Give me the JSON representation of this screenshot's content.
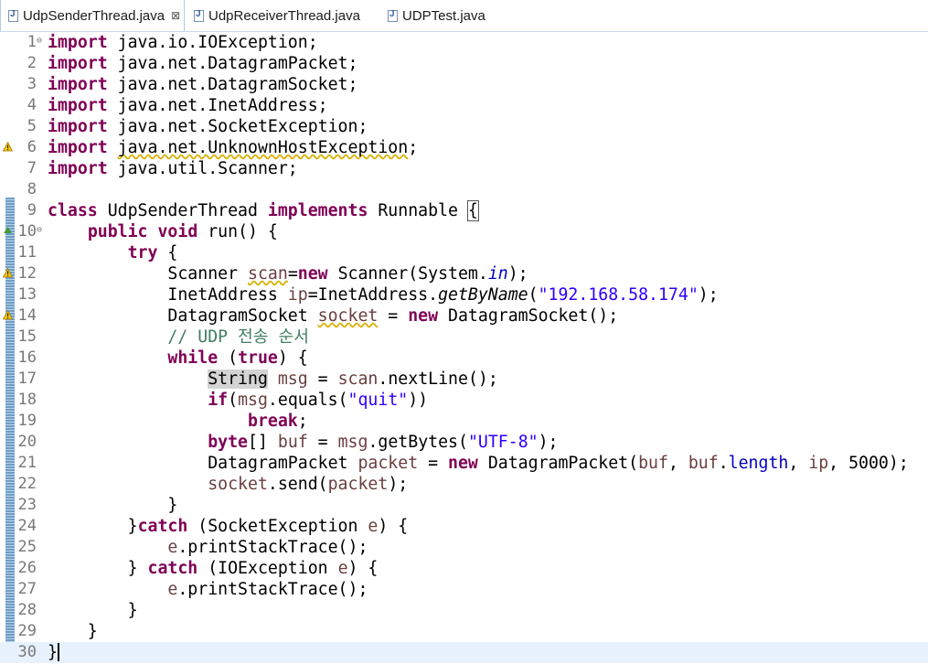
{
  "tabs": [
    {
      "label": "UdpSenderThread.java",
      "active": true,
      "close_glyph": "⊠"
    },
    {
      "label": "UdpReceiverThread.java",
      "active": false
    },
    {
      "label": "UDPTest.java",
      "active": false
    }
  ],
  "editor": {
    "current_line": 30,
    "lines": [
      {
        "n": "1",
        "fold": "⊖",
        "marker": null,
        "tokens": [
          {
            "t": "import",
            "c": "kw"
          },
          {
            "t": " java.io.IOException;"
          }
        ]
      },
      {
        "n": "2",
        "tokens": [
          {
            "t": "import",
            "c": "kw"
          },
          {
            "t": " java.net.DatagramPacket;"
          }
        ]
      },
      {
        "n": "3",
        "tokens": [
          {
            "t": "import",
            "c": "kw"
          },
          {
            "t": " java.net.DatagramSocket;"
          }
        ]
      },
      {
        "n": "4",
        "tokens": [
          {
            "t": "import",
            "c": "kw"
          },
          {
            "t": " java.net.InetAddress;"
          }
        ]
      },
      {
        "n": "5",
        "tokens": [
          {
            "t": "import",
            "c": "kw"
          },
          {
            "t": " java.net.SocketException;"
          }
        ]
      },
      {
        "n": "6",
        "marker": "warning",
        "tokens": [
          {
            "t": "import",
            "c": "kw"
          },
          {
            "t": " "
          },
          {
            "t": "java.net.UnknownHostException",
            "c": "wv"
          },
          {
            "t": ";"
          }
        ]
      },
      {
        "n": "7",
        "tokens": [
          {
            "t": "import",
            "c": "kw"
          },
          {
            "t": " java.util.Scanner;"
          }
        ]
      },
      {
        "n": "8",
        "tokens": []
      },
      {
        "n": "9",
        "tokens": [
          {
            "t": "class",
            "c": "kw"
          },
          {
            "t": " UdpSenderThread "
          },
          {
            "t": "implements",
            "c": "kw"
          },
          {
            "t": " Runnable "
          },
          {
            "t": "{",
            "c": "bx"
          }
        ]
      },
      {
        "n": "10",
        "fold": "⊖",
        "marker": "override",
        "tokens": [
          {
            "t": "    "
          },
          {
            "t": "public",
            "c": "kw"
          },
          {
            "t": " "
          },
          {
            "t": "void",
            "c": "kw"
          },
          {
            "t": " run() {"
          }
        ]
      },
      {
        "n": "11",
        "tokens": [
          {
            "t": "        "
          },
          {
            "t": "try",
            "c": "kw"
          },
          {
            "t": " {"
          }
        ]
      },
      {
        "n": "12",
        "marker": "warning",
        "tokens": [
          {
            "t": "            Scanner "
          },
          {
            "t": "scan",
            "c": "lv wv"
          },
          {
            "t": "="
          },
          {
            "t": "new",
            "c": "kw"
          },
          {
            "t": " Scanner(System."
          },
          {
            "t": "in",
            "c": "st"
          },
          {
            "t": ");"
          }
        ]
      },
      {
        "n": "13",
        "tokens": [
          {
            "t": "            InetAddress "
          },
          {
            "t": "ip",
            "c": "lv"
          },
          {
            "t": "=InetAddress."
          },
          {
            "t": "getByName",
            "c": "mi"
          },
          {
            "t": "("
          },
          {
            "t": "\"192.168.58.174\"",
            "c": "str"
          },
          {
            "t": ");"
          }
        ]
      },
      {
        "n": "14",
        "marker": "warning",
        "tokens": [
          {
            "t": "            DatagramSocket "
          },
          {
            "t": "socket",
            "c": "lv wv"
          },
          {
            "t": " = "
          },
          {
            "t": "new",
            "c": "kw"
          },
          {
            "t": " DatagramSocket();"
          }
        ]
      },
      {
        "n": "15",
        "tokens": [
          {
            "t": "            "
          },
          {
            "t": "// UDP 전송 순서",
            "c": "cmt"
          }
        ]
      },
      {
        "n": "16",
        "tokens": [
          {
            "t": "            "
          },
          {
            "t": "while",
            "c": "kw"
          },
          {
            "t": " ("
          },
          {
            "t": "true",
            "c": "kw"
          },
          {
            "t": ") {"
          }
        ]
      },
      {
        "n": "17",
        "tokens": [
          {
            "t": "                "
          },
          {
            "t": "String",
            "c": "hl"
          },
          {
            "t": " "
          },
          {
            "t": "msg",
            "c": "lv"
          },
          {
            "t": " = "
          },
          {
            "t": "scan",
            "c": "lv"
          },
          {
            "t": ".nextLine();"
          }
        ]
      },
      {
        "n": "18",
        "tokens": [
          {
            "t": "                "
          },
          {
            "t": "if",
            "c": "kw"
          },
          {
            "t": "("
          },
          {
            "t": "msg",
            "c": "lv"
          },
          {
            "t": ".equals("
          },
          {
            "t": "\"quit\"",
            "c": "str"
          },
          {
            "t": "))"
          }
        ]
      },
      {
        "n": "19",
        "tokens": [
          {
            "t": "                    "
          },
          {
            "t": "break",
            "c": "kw"
          },
          {
            "t": ";"
          }
        ]
      },
      {
        "n": "20",
        "tokens": [
          {
            "t": "                "
          },
          {
            "t": "byte",
            "c": "kw"
          },
          {
            "t": "[] "
          },
          {
            "t": "buf",
            "c": "lv"
          },
          {
            "t": " = "
          },
          {
            "t": "msg",
            "c": "lv"
          },
          {
            "t": ".getBytes("
          },
          {
            "t": "\"UTF-8\"",
            "c": "str"
          },
          {
            "t": ");"
          }
        ]
      },
      {
        "n": "21",
        "tokens": [
          {
            "t": "                DatagramPacket "
          },
          {
            "t": "packet",
            "c": "lv"
          },
          {
            "t": " = "
          },
          {
            "t": "new",
            "c": "kw"
          },
          {
            "t": " DatagramPacket("
          },
          {
            "t": "buf",
            "c": "lv"
          },
          {
            "t": ", "
          },
          {
            "t": "buf",
            "c": "lv"
          },
          {
            "t": "."
          },
          {
            "t": "length",
            "c": "fld"
          },
          {
            "t": ", "
          },
          {
            "t": "ip",
            "c": "lv"
          },
          {
            "t": ", 5000);"
          }
        ]
      },
      {
        "n": "22",
        "tokens": [
          {
            "t": "                "
          },
          {
            "t": "socket",
            "c": "lv"
          },
          {
            "t": ".send("
          },
          {
            "t": "packet",
            "c": "lv"
          },
          {
            "t": ");"
          }
        ]
      },
      {
        "n": "23",
        "tokens": [
          {
            "t": "            }"
          }
        ]
      },
      {
        "n": "24",
        "tokens": [
          {
            "t": "        }"
          },
          {
            "t": "catch",
            "c": "kw"
          },
          {
            "t": " (SocketException "
          },
          {
            "t": "e",
            "c": "lv"
          },
          {
            "t": ") {"
          }
        ]
      },
      {
        "n": "25",
        "tokens": [
          {
            "t": "            "
          },
          {
            "t": "e",
            "c": "lv"
          },
          {
            "t": ".printStackTrace();"
          }
        ]
      },
      {
        "n": "26",
        "tokens": [
          {
            "t": "        } "
          },
          {
            "t": "catch",
            "c": "kw"
          },
          {
            "t": " (IOException "
          },
          {
            "t": "e",
            "c": "lv"
          },
          {
            "t": ") {"
          }
        ]
      },
      {
        "n": "27",
        "tokens": [
          {
            "t": "            "
          },
          {
            "t": "e",
            "c": "lv"
          },
          {
            "t": ".printStackTrace();"
          }
        ]
      },
      {
        "n": "28",
        "tokens": [
          {
            "t": "        }"
          }
        ]
      },
      {
        "n": "29",
        "tokens": [
          {
            "t": "    }"
          }
        ]
      },
      {
        "n": "30",
        "tokens": [
          {
            "t": "}"
          }
        ],
        "caret": true
      }
    ]
  }
}
